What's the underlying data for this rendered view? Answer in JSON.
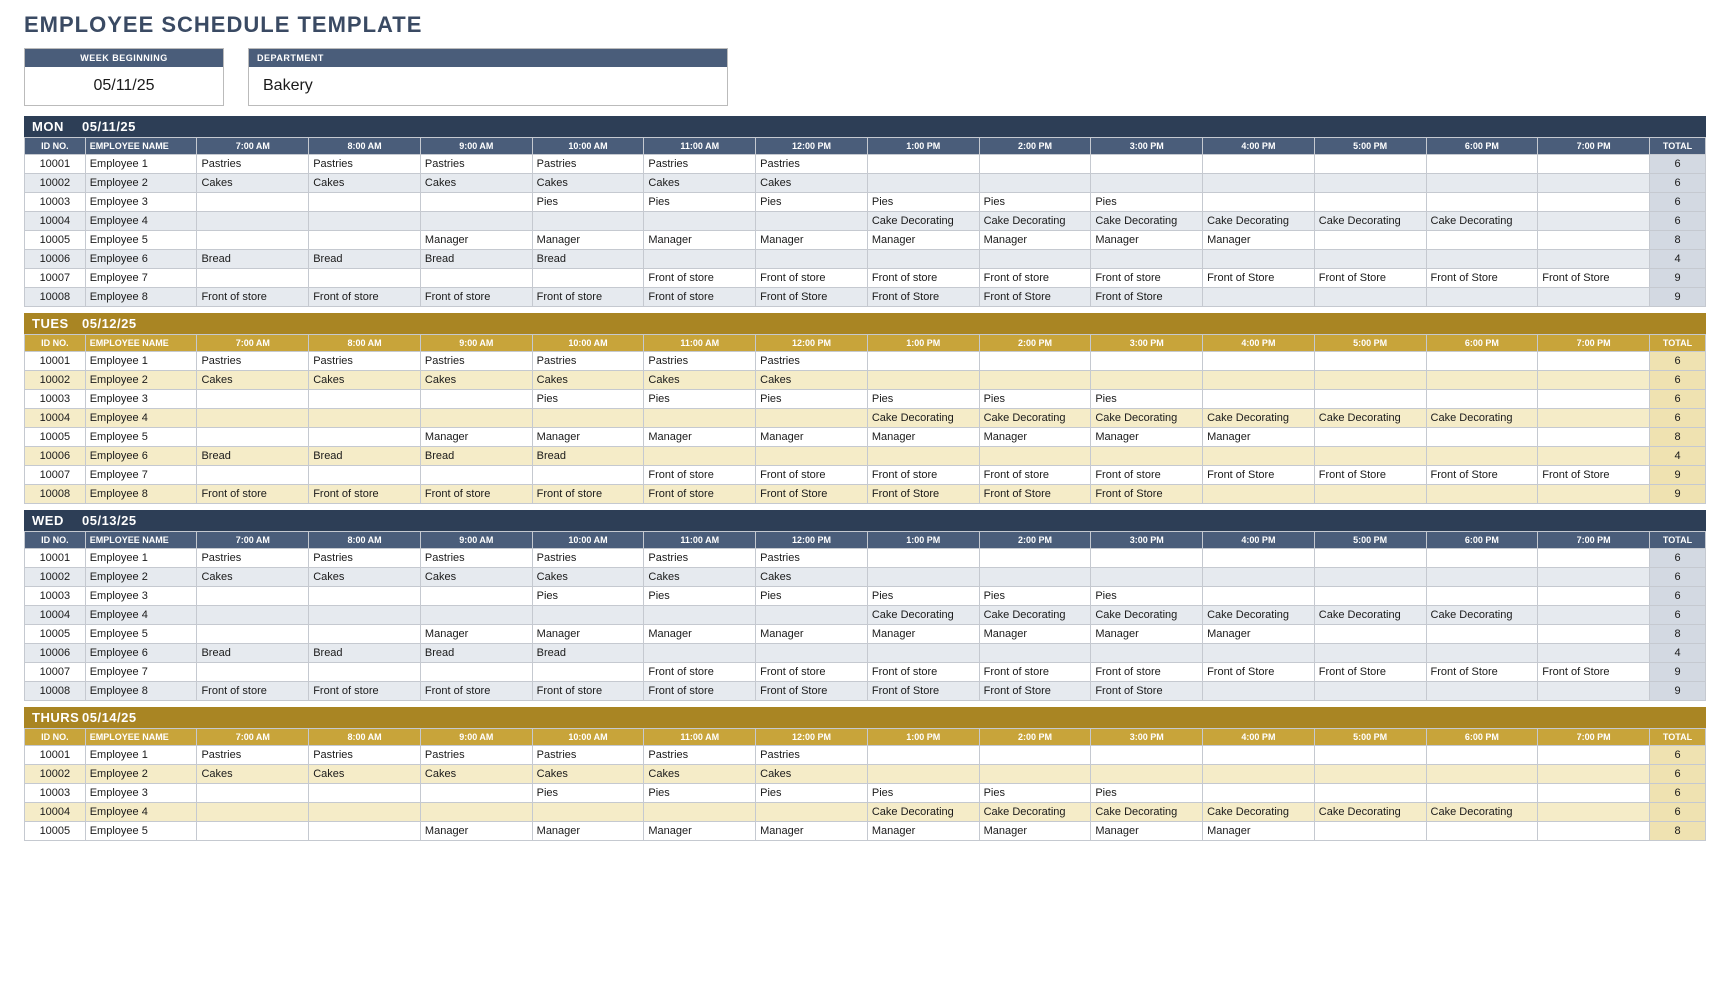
{
  "title": "EMPLOYEE SCHEDULE TEMPLATE",
  "info": {
    "week_label": "WEEK BEGINNING",
    "week_value": "05/11/25",
    "dept_label": "DEPARTMENT",
    "dept_value": "Bakery"
  },
  "headers": {
    "id": "ID NO.",
    "name": "EMPLOYEE NAME",
    "total": "TOTAL",
    "hours": [
      "7:00 AM",
      "8:00 AM",
      "9:00 AM",
      "10:00 AM",
      "11:00 AM",
      "12:00 PM",
      "1:00 PM",
      "2:00 PM",
      "3:00 PM",
      "4:00 PM",
      "5:00 PM",
      "6:00 PM",
      "7:00 PM"
    ]
  },
  "days": [
    {
      "theme": "navy",
      "dow": "MON",
      "date": "05/11/25",
      "rows": [
        {
          "id": "10001",
          "name": "Employee 1",
          "cells": [
            "Pastries",
            "Pastries",
            "Pastries",
            "Pastries",
            "Pastries",
            "Pastries",
            "",
            "",
            "",
            "",
            "",
            "",
            ""
          ],
          "total": "6"
        },
        {
          "id": "10002",
          "name": "Employee 2",
          "cells": [
            "Cakes",
            "Cakes",
            "Cakes",
            "Cakes",
            "Cakes",
            "Cakes",
            "",
            "",
            "",
            "",
            "",
            "",
            ""
          ],
          "total": "6"
        },
        {
          "id": "10003",
          "name": "Employee 3",
          "cells": [
            "",
            "",
            "",
            "Pies",
            "Pies",
            "Pies",
            "Pies",
            "Pies",
            "Pies",
            "",
            "",
            "",
            ""
          ],
          "total": "6"
        },
        {
          "id": "10004",
          "name": "Employee 4",
          "cells": [
            "",
            "",
            "",
            "",
            "",
            "",
            "Cake Decorating",
            "Cake Decorating",
            "Cake Decorating",
            "Cake Decorating",
            "Cake Decorating",
            "Cake Decorating",
            ""
          ],
          "total": "6"
        },
        {
          "id": "10005",
          "name": "Employee 5",
          "cells": [
            "",
            "",
            "Manager",
            "Manager",
            "Manager",
            "Manager",
            "Manager",
            "Manager",
            "Manager",
            "Manager",
            "",
            "",
            ""
          ],
          "total": "8"
        },
        {
          "id": "10006",
          "name": "Employee 6",
          "cells": [
            "Bread",
            "Bread",
            "Bread",
            "Bread",
            "",
            "",
            "",
            "",
            "",
            "",
            "",
            "",
            ""
          ],
          "total": "4"
        },
        {
          "id": "10007",
          "name": "Employee 7",
          "cells": [
            "",
            "",
            "",
            "",
            "Front of store",
            "Front of store",
            "Front of store",
            "Front of store",
            "Front of store",
            "Front of Store",
            "Front of Store",
            "Front of Store",
            "Front of Store"
          ],
          "total": "9"
        },
        {
          "id": "10008",
          "name": "Employee 8",
          "cells": [
            "Front of store",
            "Front of store",
            "Front of store",
            "Front of store",
            "Front of store",
            "Front of Store",
            "Front of Store",
            "Front of Store",
            "Front of Store",
            "",
            "",
            "",
            ""
          ],
          "total": "9"
        }
      ]
    },
    {
      "theme": "gold",
      "dow": "TUES",
      "date": "05/12/25",
      "rows": [
        {
          "id": "10001",
          "name": "Employee 1",
          "cells": [
            "Pastries",
            "Pastries",
            "Pastries",
            "Pastries",
            "Pastries",
            "Pastries",
            "",
            "",
            "",
            "",
            "",
            "",
            ""
          ],
          "total": "6"
        },
        {
          "id": "10002",
          "name": "Employee 2",
          "cells": [
            "Cakes",
            "Cakes",
            "Cakes",
            "Cakes",
            "Cakes",
            "Cakes",
            "",
            "",
            "",
            "",
            "",
            "",
            ""
          ],
          "total": "6"
        },
        {
          "id": "10003",
          "name": "Employee 3",
          "cells": [
            "",
            "",
            "",
            "Pies",
            "Pies",
            "Pies",
            "Pies",
            "Pies",
            "Pies",
            "",
            "",
            "",
            ""
          ],
          "total": "6"
        },
        {
          "id": "10004",
          "name": "Employee 4",
          "cells": [
            "",
            "",
            "",
            "",
            "",
            "",
            "Cake Decorating",
            "Cake Decorating",
            "Cake Decorating",
            "Cake Decorating",
            "Cake Decorating",
            "Cake Decorating",
            ""
          ],
          "total": "6"
        },
        {
          "id": "10005",
          "name": "Employee 5",
          "cells": [
            "",
            "",
            "Manager",
            "Manager",
            "Manager",
            "Manager",
            "Manager",
            "Manager",
            "Manager",
            "Manager",
            "",
            "",
            ""
          ],
          "total": "8"
        },
        {
          "id": "10006",
          "name": "Employee 6",
          "cells": [
            "Bread",
            "Bread",
            "Bread",
            "Bread",
            "",
            "",
            "",
            "",
            "",
            "",
            "",
            "",
            ""
          ],
          "total": "4"
        },
        {
          "id": "10007",
          "name": "Employee 7",
          "cells": [
            "",
            "",
            "",
            "",
            "Front of store",
            "Front of store",
            "Front of store",
            "Front of store",
            "Front of store",
            "Front of Store",
            "Front of Store",
            "Front of Store",
            "Front of Store"
          ],
          "total": "9"
        },
        {
          "id": "10008",
          "name": "Employee 8",
          "cells": [
            "Front of store",
            "Front of store",
            "Front of store",
            "Front of store",
            "Front of store",
            "Front of Store",
            "Front of Store",
            "Front of Store",
            "Front of Store",
            "",
            "",
            "",
            ""
          ],
          "total": "9"
        }
      ]
    },
    {
      "theme": "navy",
      "dow": "WED",
      "date": "05/13/25",
      "rows": [
        {
          "id": "10001",
          "name": "Employee 1",
          "cells": [
            "Pastries",
            "Pastries",
            "Pastries",
            "Pastries",
            "Pastries",
            "Pastries",
            "",
            "",
            "",
            "",
            "",
            "",
            ""
          ],
          "total": "6"
        },
        {
          "id": "10002",
          "name": "Employee 2",
          "cells": [
            "Cakes",
            "Cakes",
            "Cakes",
            "Cakes",
            "Cakes",
            "Cakes",
            "",
            "",
            "",
            "",
            "",
            "",
            ""
          ],
          "total": "6"
        },
        {
          "id": "10003",
          "name": "Employee 3",
          "cells": [
            "",
            "",
            "",
            "Pies",
            "Pies",
            "Pies",
            "Pies",
            "Pies",
            "Pies",
            "",
            "",
            "",
            ""
          ],
          "total": "6"
        },
        {
          "id": "10004",
          "name": "Employee 4",
          "cells": [
            "",
            "",
            "",
            "",
            "",
            "",
            "Cake Decorating",
            "Cake Decorating",
            "Cake Decorating",
            "Cake Decorating",
            "Cake Decorating",
            "Cake Decorating",
            ""
          ],
          "total": "6"
        },
        {
          "id": "10005",
          "name": "Employee 5",
          "cells": [
            "",
            "",
            "Manager",
            "Manager",
            "Manager",
            "Manager",
            "Manager",
            "Manager",
            "Manager",
            "Manager",
            "",
            "",
            ""
          ],
          "total": "8"
        },
        {
          "id": "10006",
          "name": "Employee 6",
          "cells": [
            "Bread",
            "Bread",
            "Bread",
            "Bread",
            "",
            "",
            "",
            "",
            "",
            "",
            "",
            "",
            ""
          ],
          "total": "4"
        },
        {
          "id": "10007",
          "name": "Employee 7",
          "cells": [
            "",
            "",
            "",
            "",
            "Front of store",
            "Front of store",
            "Front of store",
            "Front of store",
            "Front of store",
            "Front of Store",
            "Front of Store",
            "Front of Store",
            "Front of Store"
          ],
          "total": "9"
        },
        {
          "id": "10008",
          "name": "Employee 8",
          "cells": [
            "Front of store",
            "Front of store",
            "Front of store",
            "Front of store",
            "Front of store",
            "Front of Store",
            "Front of Store",
            "Front of Store",
            "Front of Store",
            "",
            "",
            "",
            ""
          ],
          "total": "9"
        }
      ]
    },
    {
      "theme": "gold",
      "dow": "THURS",
      "date": "05/14/25",
      "rows": [
        {
          "id": "10001",
          "name": "Employee 1",
          "cells": [
            "Pastries",
            "Pastries",
            "Pastries",
            "Pastries",
            "Pastries",
            "Pastries",
            "",
            "",
            "",
            "",
            "",
            "",
            ""
          ],
          "total": "6"
        },
        {
          "id": "10002",
          "name": "Employee 2",
          "cells": [
            "Cakes",
            "Cakes",
            "Cakes",
            "Cakes",
            "Cakes",
            "Cakes",
            "",
            "",
            "",
            "",
            "",
            "",
            ""
          ],
          "total": "6"
        },
        {
          "id": "10003",
          "name": "Employee 3",
          "cells": [
            "",
            "",
            "",
            "Pies",
            "Pies",
            "Pies",
            "Pies",
            "Pies",
            "Pies",
            "",
            "",
            "",
            ""
          ],
          "total": "6"
        },
        {
          "id": "10004",
          "name": "Employee 4",
          "cells": [
            "",
            "",
            "",
            "",
            "",
            "",
            "Cake Decorating",
            "Cake Decorating",
            "Cake Decorating",
            "Cake Decorating",
            "Cake Decorating",
            "Cake Decorating",
            ""
          ],
          "total": "6"
        },
        {
          "id": "10005",
          "name": "Employee 5",
          "cells": [
            "",
            "",
            "Manager",
            "Manager",
            "Manager",
            "Manager",
            "Manager",
            "Manager",
            "Manager",
            "Manager",
            "",
            "",
            ""
          ],
          "total": "8"
        }
      ]
    }
  ]
}
